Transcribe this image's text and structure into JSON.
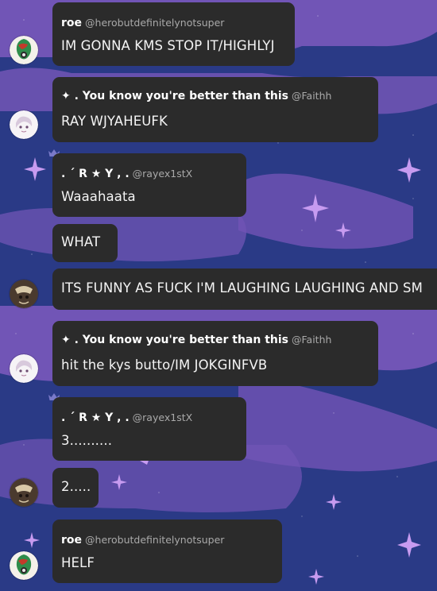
{
  "messages": [
    {
      "name": "roe",
      "handle": "@herobutdefinitelynotsuper",
      "text": "IM GONNA KMS STOP IT/HIGHLYJ"
    },
    {
      "name": "✦ . You know you're better than this",
      "handle": "@Faithh",
      "text": "RAY WJYAHEUFK"
    },
    {
      "name": ". ´ R ★ Y , .",
      "handle": "@rayex1stX",
      "text": "Waaahaata"
    },
    {
      "text": "WHAT"
    },
    {
      "text": "ITS FUNNY AS FUCK I'M LAUGHING LAUGHING AND SM"
    },
    {
      "name": "✦ . You know you're better than this",
      "handle": "@Faithh",
      "text": "hit the kys butto/IM JOKGINFVB"
    },
    {
      "name": ". ´ R ★ Y , .",
      "handle": "@rayex1stX",
      "text": "3.........."
    },
    {
      "text": "2....."
    },
    {
      "name": "roe",
      "handle": "@herobutdefinitelynotsuper",
      "text": "HELF"
    }
  ],
  "colors": {
    "bubble": "#2b2b2b",
    "background": "#2a3a86",
    "purple": "#7f5fc0",
    "sparkle": "#b48ce6",
    "crown": "#7a7ac8"
  },
  "avatars": [
    "roe-avatar",
    "faithh-avatar",
    "dark-avatar"
  ],
  "icons": [
    "crown-icon",
    "sparkle-icon"
  ]
}
